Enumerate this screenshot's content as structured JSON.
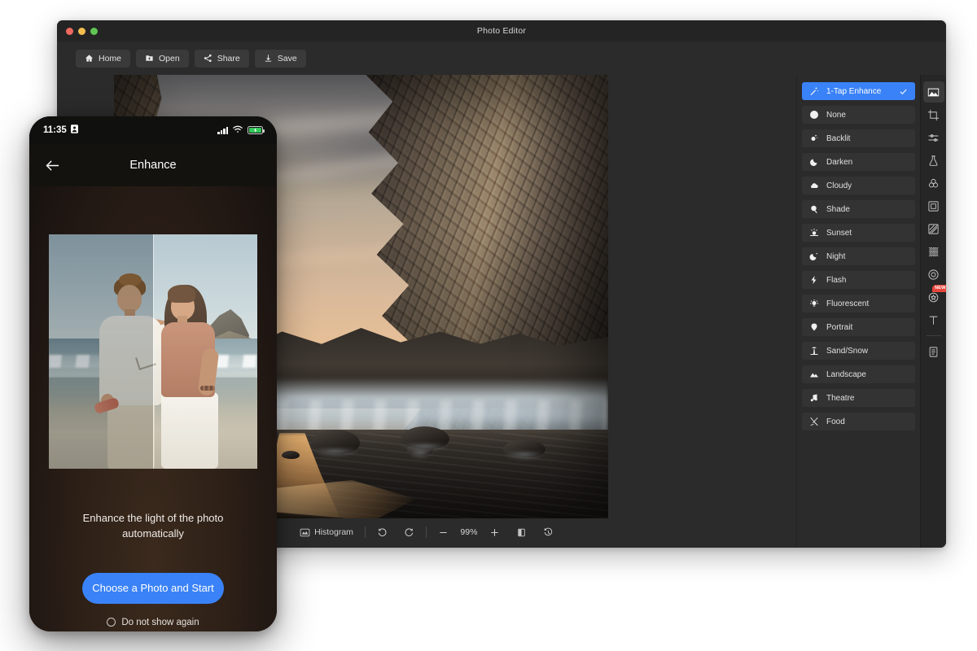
{
  "window": {
    "title": "Photo Editor",
    "traffic_lights": [
      "close",
      "minimize",
      "maximize"
    ],
    "toolbar": [
      {
        "label": "Home",
        "icon": "home-icon"
      },
      {
        "label": "Open",
        "icon": "folder-plus-icon"
      },
      {
        "label": "Share",
        "icon": "share-icon"
      },
      {
        "label": "Save",
        "icon": "download-icon"
      }
    ]
  },
  "statusbar": {
    "histogram_label": "Histogram",
    "histogram_icon": "histogram-icon",
    "undo_icon": "undo-icon",
    "redo_icon": "redo-icon",
    "zoom_out_icon": "minus-icon",
    "zoom_level": "99%",
    "zoom_in_icon": "plus-icon",
    "compare_icon": "compare-split-icon",
    "reset_icon": "reset-history-icon"
  },
  "presets": {
    "items": [
      {
        "label": "1-Tap Enhance",
        "icon": "magic-wand-icon",
        "selected": true
      },
      {
        "label": "None",
        "icon": "no-entry-icon",
        "selected": false
      },
      {
        "label": "Backlit",
        "icon": "backlit-sun-icon",
        "selected": false
      },
      {
        "label": "Darken",
        "icon": "moon-icon",
        "selected": false
      },
      {
        "label": "Cloudy",
        "icon": "cloud-icon",
        "selected": false
      },
      {
        "label": "Shade",
        "icon": "shade-icon",
        "selected": false
      },
      {
        "label": "Sunset",
        "icon": "sunset-icon",
        "selected": false
      },
      {
        "label": "Night",
        "icon": "night-moon-star-icon",
        "selected": false
      },
      {
        "label": "Flash",
        "icon": "flash-bolt-icon",
        "selected": false
      },
      {
        "label": "Fluorescent",
        "icon": "fluorescent-bulb-icon",
        "selected": false
      },
      {
        "label": "Portrait",
        "icon": "portrait-icon",
        "selected": false
      },
      {
        "label": "Sand/Snow",
        "icon": "palm-beach-icon",
        "selected": false
      },
      {
        "label": "Landscape",
        "icon": "mountain-icon",
        "selected": false
      },
      {
        "label": "Theatre",
        "icon": "music-note-icon",
        "selected": false
      },
      {
        "label": "Food",
        "icon": "fork-knife-icon",
        "selected": false
      }
    ],
    "check_icon": "checkmark-icon"
  },
  "rail": {
    "tools": [
      {
        "name": "enhance-landscape-tool",
        "icon": "mountain-photo-icon",
        "active": true,
        "badge": ""
      },
      {
        "name": "crop-tool",
        "icon": "crop-icon",
        "active": false,
        "badge": ""
      },
      {
        "name": "adjust-tool",
        "icon": "sliders-icon",
        "active": false,
        "badge": ""
      },
      {
        "name": "filters-tool",
        "icon": "flask-icon",
        "active": false,
        "badge": ""
      },
      {
        "name": "color-mix-tool",
        "icon": "color-circles-icon",
        "active": false,
        "badge": ""
      },
      {
        "name": "frame-tool",
        "icon": "frame-square-icon",
        "active": false,
        "badge": ""
      },
      {
        "name": "split-tone-tool",
        "icon": "diagonal-split-icon",
        "active": false,
        "badge": ""
      },
      {
        "name": "texture-tool",
        "icon": "texture-grid-icon",
        "active": false,
        "badge": ""
      },
      {
        "name": "vignette-tool",
        "icon": "vignette-circle-icon",
        "active": false,
        "badge": ""
      },
      {
        "name": "effects-tool",
        "icon": "star-burst-icon",
        "active": false,
        "badge": "NEW"
      },
      {
        "name": "text-tool",
        "icon": "text-t-icon",
        "active": false,
        "badge": ""
      },
      {
        "name": "notes-tool",
        "icon": "clipboard-icon",
        "active": false,
        "badge": ""
      }
    ]
  },
  "phone": {
    "status": {
      "time": "11:35",
      "time_icon": "app-badge-icon",
      "signal_icon": "signal-bars-icon",
      "wifi_icon": "wifi-icon",
      "battery_icon": "battery-charging-icon"
    },
    "nav": {
      "back_icon": "arrow-left-icon",
      "title": "Enhance"
    },
    "photo": {
      "name": "before-after-beach-couple",
      "split": "before-after"
    },
    "caption": "Enhance the light of the photo automatically",
    "cta_label": "Choose a Photo and Start",
    "checkbox_label": "Do not show again",
    "checkbox_checked": false
  },
  "colors": {
    "accent_blue": "#3a82f7",
    "badge_red": "#e8453c",
    "window_bg": "#2b2b2b",
    "rail_bg": "#262626",
    "preset_bg": "#333333",
    "phone_bg": "#231a14",
    "battery_green": "#34c759"
  }
}
